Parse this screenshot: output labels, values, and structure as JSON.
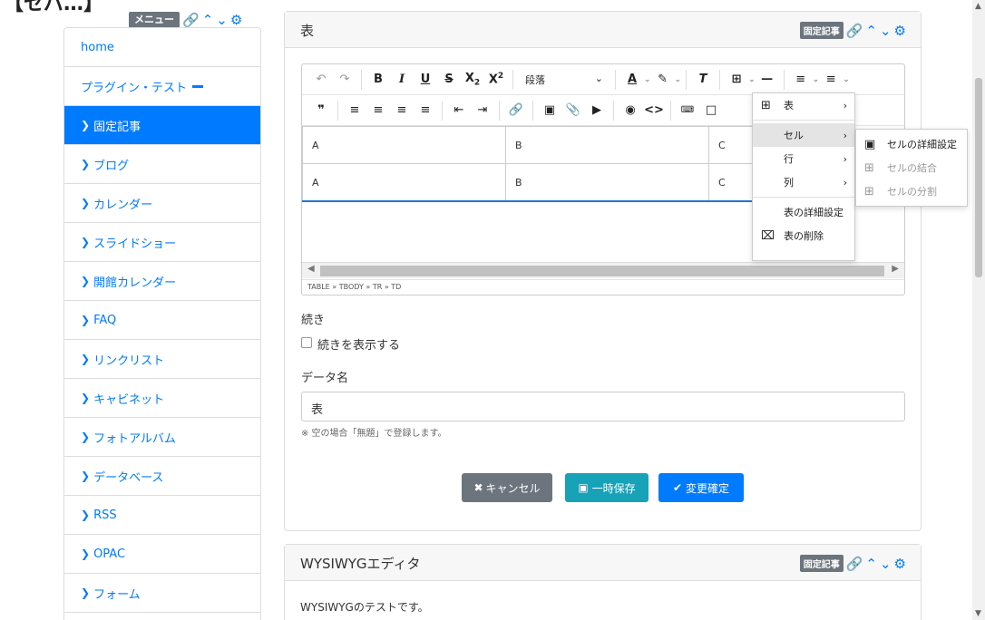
{
  "page": {
    "top_title": "【セパ…】"
  },
  "menu_frame": {
    "badge": "メニュー"
  },
  "sidebar": {
    "items": [
      {
        "label": "home",
        "active": false,
        "chevron": false
      },
      {
        "label": "プラグイン・テスト",
        "active": false,
        "chevron": false,
        "collapse": true
      },
      {
        "label": "固定記事",
        "active": true,
        "chevron": true
      },
      {
        "label": "ブログ",
        "active": false,
        "chevron": true
      },
      {
        "label": "カレンダー",
        "active": false,
        "chevron": true
      },
      {
        "label": "スライドショー",
        "active": false,
        "chevron": true
      },
      {
        "label": "開館カレンダー",
        "active": false,
        "chevron": true
      },
      {
        "label": "FAQ",
        "active": false,
        "chevron": true
      },
      {
        "label": "リンクリスト",
        "active": false,
        "chevron": true
      },
      {
        "label": "キャビネット",
        "active": false,
        "chevron": true
      },
      {
        "label": "フォトアルバム",
        "active": false,
        "chevron": true
      },
      {
        "label": "データベース",
        "active": false,
        "chevron": true
      },
      {
        "label": "RSS",
        "active": false,
        "chevron": true
      },
      {
        "label": "OPAC",
        "active": false,
        "chevron": true
      },
      {
        "label": "フォーム",
        "active": false,
        "chevron": true
      }
    ]
  },
  "panel": {
    "title": "表",
    "badge": "固定記事"
  },
  "editor": {
    "paragraph_select": "段落",
    "table": [
      [
        "A",
        "B",
        "C"
      ],
      [
        "A",
        "B",
        "C"
      ]
    ],
    "statusbar": "TABLE » TBODY » TR » TD"
  },
  "table_menu": {
    "items": [
      {
        "label": "表",
        "submenu": true,
        "icon": "table-icon"
      },
      {
        "label": "セル",
        "submenu": true,
        "highlight": true
      },
      {
        "label": "行",
        "submenu": true
      },
      {
        "label": "列",
        "submenu": true
      },
      {
        "label": "表の詳細設定"
      },
      {
        "label": "表の削除",
        "icon": "delete-table-icon"
      }
    ]
  },
  "cell_menu": {
    "items": [
      {
        "label": "セルの詳細設定",
        "disabled": false
      },
      {
        "label": "セルの結合",
        "disabled": true
      },
      {
        "label": "セルの分割",
        "disabled": true
      }
    ]
  },
  "form": {
    "continue_label": "続き",
    "continue_checkbox": "続きを表示する",
    "data_name_label": "データ名",
    "data_name_value": "表",
    "note": "※ 空の場合「無題」で登録します。"
  },
  "buttons": {
    "cancel": "キャンセル",
    "temp_save": "一時保存",
    "confirm": "変更確定"
  },
  "colors": {
    "primary": "#007bff",
    "secondary": "#6c757d",
    "info": "#17a2b8"
  },
  "panel2": {
    "title": "WYSIWYGエディタ",
    "badge": "固定記事",
    "body": "WYSIWYGのテストです。"
  }
}
